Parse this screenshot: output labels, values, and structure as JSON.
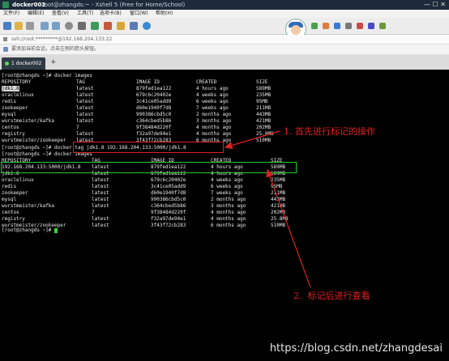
{
  "titlebar": {
    "app_name": "docker002",
    "window_title": "root@zhangds:~ - Xshell 5 (Free for Home/School)",
    "window_buttons": "— ☐ ✕"
  },
  "menubar": {
    "items": [
      "文件(F)",
      "编辑(E)",
      "查看(V)",
      "工具(T)",
      "选项卡(B)",
      "窗口(W)",
      "帮助(H)"
    ]
  },
  "address": {
    "text": "ssh://root:*********@192.168.204.133:22"
  },
  "hint": {
    "text": "要添加当前会话，点击左侧的箭头按钮。"
  },
  "tabs": {
    "active_label": "1 docker002"
  },
  "terminal": {
    "cmd1": "[root@zhangds ~]# docker images",
    "header": [
      "REPOSITORY",
      "TAG",
      "IMAGE ID",
      "CREATED",
      "SIZE"
    ],
    "rows1": [
      [
        "jdk1.8",
        "latest",
        "879fed1ea122",
        "4 hours ago",
        "589MB"
      ],
      [
        "oraclelinux",
        "latest",
        "679c6c20402e",
        "4 weeks ago",
        "235MB"
      ],
      [
        "redis",
        "latest",
        "3c41ce05add9",
        "6 weeks ago",
        "95MB"
      ],
      [
        "zookeeper",
        "latest",
        "d60e1940f7d8",
        "7 weeks ago",
        "211MB"
      ],
      [
        "mysql",
        "latest",
        "990386cbd5c0",
        "2 months ago",
        "443MB"
      ],
      [
        "wurstmeister/kafka",
        "latest",
        "c364cbed5b86",
        "3 months ago",
        "421MB"
      ],
      [
        "centos",
        "7",
        "9f38484d220f",
        "4 months ago",
        "202MB"
      ],
      [
        "registry",
        "latest",
        "f32a97de94e1",
        "4 months ago",
        "25.8MB"
      ],
      [
        "wurstmeister/zookeeper",
        "latest",
        "3f43f72cb283",
        "6 months ago",
        "510MB"
      ]
    ],
    "cmd2": "[root@zhangds ~]# docker tag jdk1.8 192.168.204.133:5000/jdk1.8",
    "cmd3": "[root@zhangds ~]# docker images",
    "rows2": [
      [
        "192.168.204.133:5000/jdk1.8",
        "latest",
        "879fed1ea122",
        "4 hours ago",
        "589MB"
      ],
      [
        "jdk1.8",
        "latest",
        "879fed1ea122",
        "4 hours ago",
        "589MB"
      ],
      [
        "oraclelinux",
        "latest",
        "679c6c20402e",
        "4 weeks ago",
        "235MB"
      ],
      [
        "redis",
        "latest",
        "3c41ce05add9",
        "6 weeks ago",
        "95MB"
      ],
      [
        "zookeeper",
        "latest",
        "d60e1940f7d8",
        "7 weeks ago",
        "211MB"
      ],
      [
        "mysql",
        "latest",
        "990386cbd5c0",
        "2 months ago",
        "443MB"
      ],
      [
        "wurstmeister/kafka",
        "latest",
        "c364cbed5b86",
        "3 months ago",
        "421MB"
      ],
      [
        "centos",
        "7",
        "9f38484d220f",
        "4 months ago",
        "202MB"
      ],
      [
        "registry",
        "latest",
        "f32a97de94e1",
        "4 months ago",
        "25.8MB"
      ],
      [
        "wurstmeister/zookeeper",
        "latest",
        "3f43f72cb283",
        "6 months ago",
        "510MB"
      ]
    ],
    "prompt": "[root@zhangds ~]# "
  },
  "annotations": {
    "step1": "1. 首先进行标记的操作",
    "step2": "2.  标记后进行查看"
  },
  "watermark": "https://blog.csdn.net/zhangdesai",
  "colors": {
    "annotation": "#e02020",
    "highlight_box": "#22cc22",
    "terminal_bg": "#000000",
    "cursor": "#3fd13f"
  },
  "toolbar_icons": [
    "new-session-icon",
    "open-folder-icon",
    "disconnect-icon",
    "copy-icon",
    "paste-icon",
    "search-icon",
    "print-icon",
    "transfer-icon",
    "script-icon",
    "lock-icon",
    "settings-icon",
    "help-icon"
  ]
}
